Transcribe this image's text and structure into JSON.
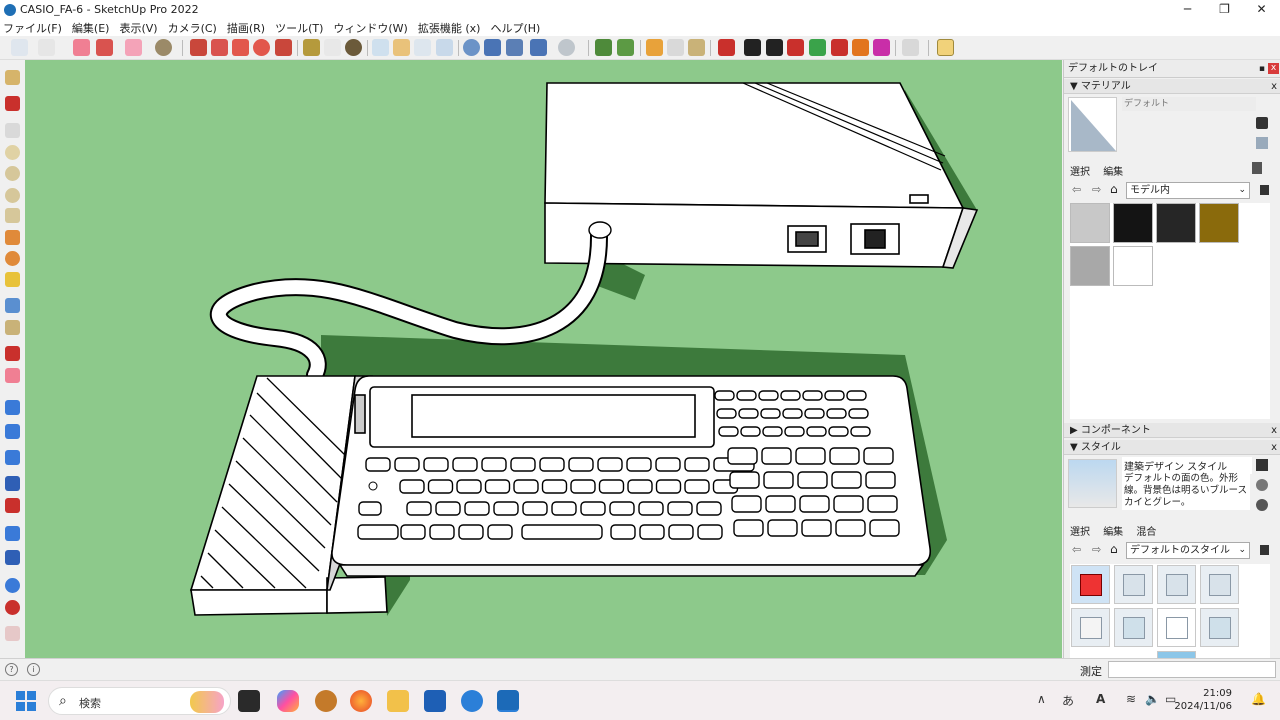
{
  "window": {
    "title": "CASIO_FA-6 - SketchUp Pro 2022",
    "minimize": "─",
    "maximize": "❐",
    "close": "✕"
  },
  "menu": [
    "ファイル(F)",
    "編集(E)",
    "表示(V)",
    "カメラ(C)",
    "描画(R)",
    "ツール(T)",
    "ウィンドウ(W)",
    "拡張機能 (x)",
    "ヘルプ(H)"
  ],
  "tray": {
    "title": "デフォルトのトレイ",
    "pin": "▪",
    "close": "x",
    "materials": {
      "header": "マテリアル",
      "expand": "▼",
      "close": "x",
      "name": "デフォルト",
      "tabs": [
        "選択",
        "編集"
      ],
      "nav_back": "⇦",
      "nav_fwd": "⇨",
      "home": "⌂",
      "collection": "モデル内",
      "chevron": "⌄",
      "swatch_colors": [
        "#c8c8c8",
        "#141414",
        "#262626",
        "#8a6a0c",
        "#a8a8a8",
        "#ffffff"
      ]
    },
    "components": {
      "header": "コンポーネント",
      "expand": "▶",
      "close": "x"
    },
    "styles": {
      "header": "スタイル",
      "expand": "▼",
      "close": "x",
      "name": "建築デザイン スタイル",
      "description": "デフォルトの面の色。外形線。背景色は明るいブルースカイとグレー。",
      "tabs": [
        "選択",
        "編集",
        "混合"
      ],
      "nav_back": "⇦",
      "nav_fwd": "⇨",
      "home": "⌂",
      "collection": "デフォルトのスタイル",
      "chevron": "⌄"
    }
  },
  "status": {
    "info_icon_1": "?",
    "info_icon_2": "i",
    "measure_label": "測定",
    "measure_value": ""
  },
  "taskbar": {
    "search_placeholder": "検索",
    "search_icon": "⌕",
    "sys_up": "∧",
    "sys_ime": "あ",
    "sys_font": "A",
    "sys_wifi": "≋",
    "sys_vol": "🔈",
    "sys_batt": "▭",
    "time": "21:09",
    "date": "2024/11/06",
    "bell": "🔔"
  },
  "colors": {
    "viewport_bg": "#8dc98b",
    "shadow": "#3d7a3c",
    "edge": "#000000",
    "face": "#ffffff"
  }
}
